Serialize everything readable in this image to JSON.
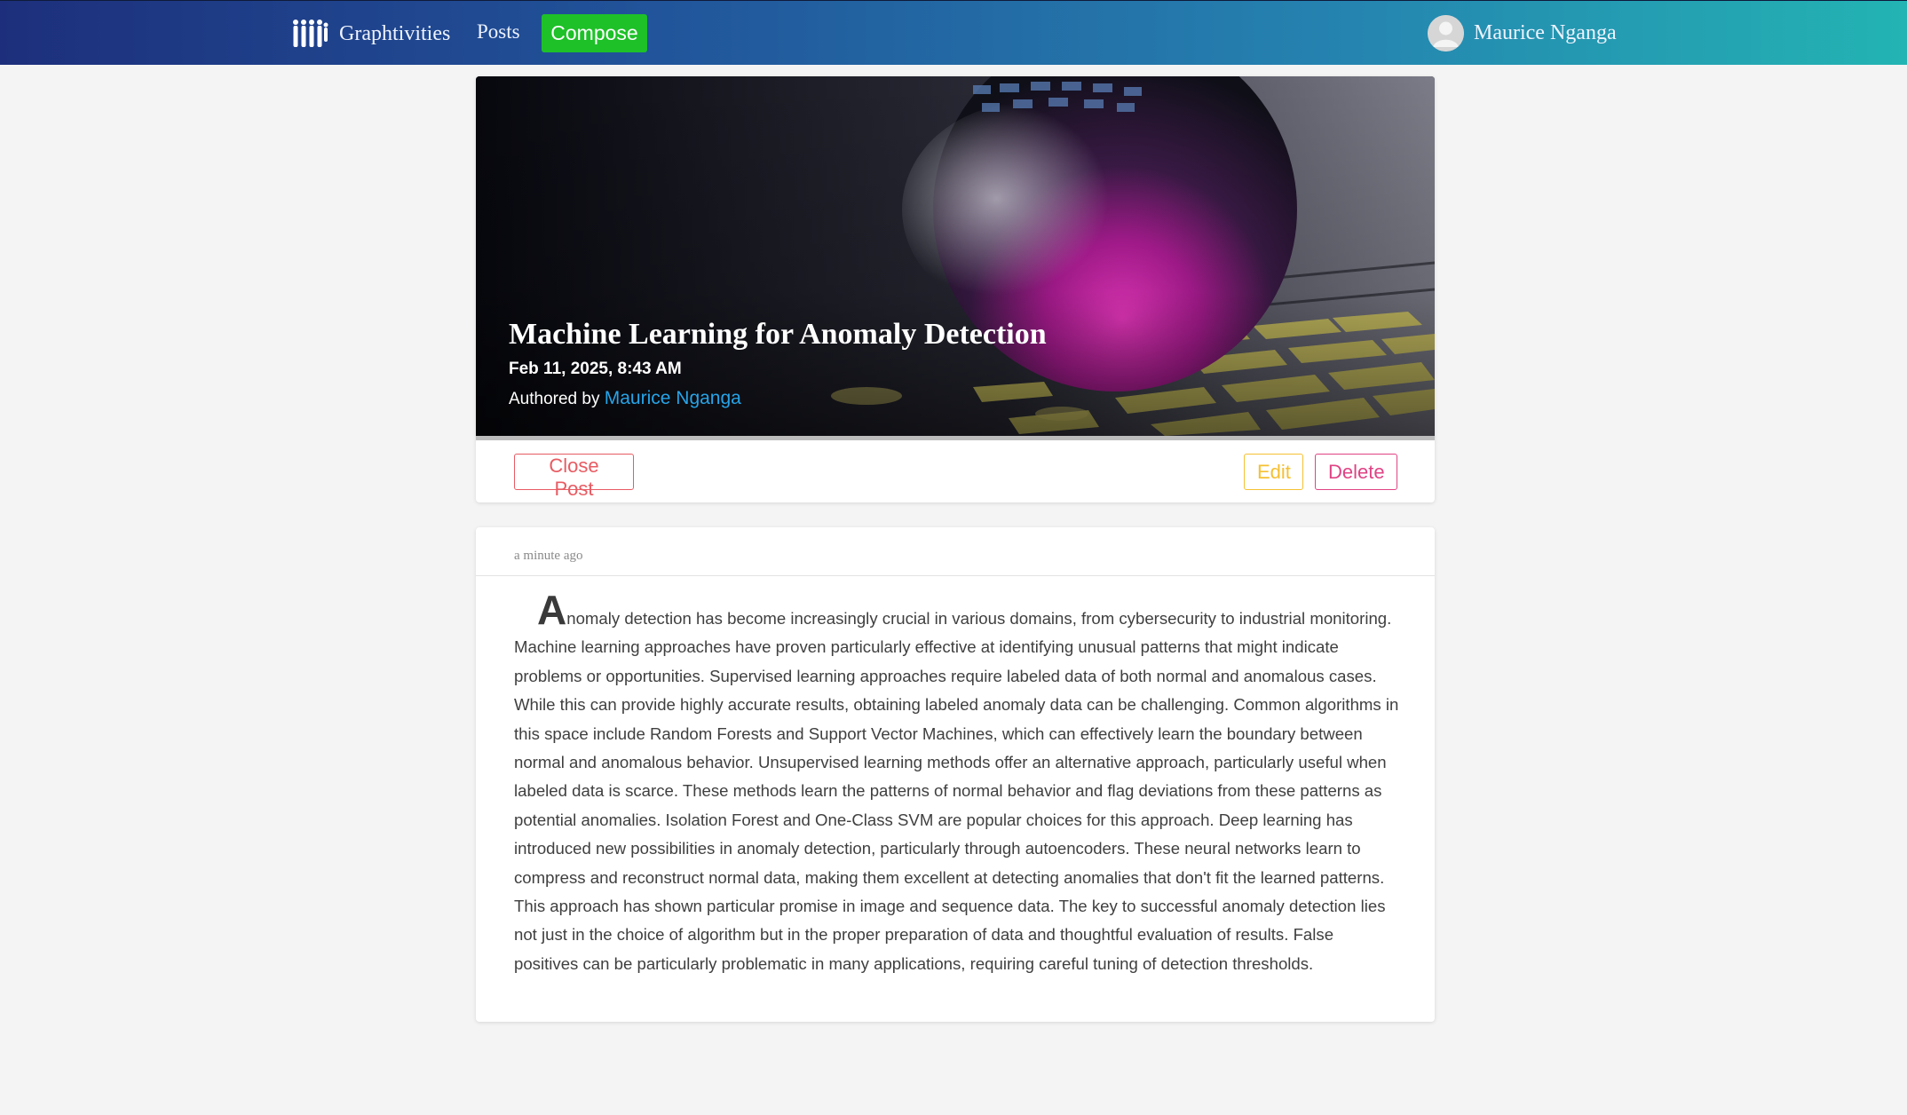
{
  "nav": {
    "brand": "Graphtivities",
    "brand_icon": "people-group-icon",
    "posts_label": "Posts",
    "compose_label": "Compose",
    "user_name": "Maurice Nganga",
    "avatar_icon": "user-avatar-icon"
  },
  "post": {
    "title": "Machine Learning for Anomaly Detection",
    "date": "Feb 11, 2025, 8:43 AM",
    "authored_prefix": "Authored by",
    "author": "Maurice Nganga",
    "close_label": "Close Post",
    "edit_label": "Edit",
    "delete_label": "Delete",
    "time_ago": "a minute ago",
    "drop_letter": "A",
    "body_rest": "nomaly detection has become increasingly crucial in various domains, from cybersecurity to industrial monitoring. Machine learning approaches have proven particularly effective at identifying unusual patterns that might indicate problems or opportunities. Supervised learning approaches require labeled data of both normal and anomalous cases. While this can provide highly accurate results, obtaining labeled anomaly data can be challenging. Common algorithms in this space include Random Forests and Support Vector Machines, which can effectively learn the boundary between normal and anomalous behavior. Unsupervised learning methods offer an alternative approach, particularly useful when labeled data is scarce. These methods learn the patterns of normal behavior and flag deviations from these patterns as potential anomalies. Isolation Forest and One-Class SVM are popular choices for this approach. Deep learning has introduced new possibilities in anomaly detection, particularly through autoencoders. These neural networks learn to compress and reconstruct normal data, making them excellent at detecting anomalies that don't fit the learned patterns. This approach has shown particular promise in image and sequence data. The key to successful anomaly detection lies not just in the choice of algorithm but in the proper preparation of data and thoughtful evaluation of results. False positives can be particularly problematic in many applications, requiring careful tuning of detection thresholds."
  },
  "colors": {
    "compose": "#1ec128",
    "close": "#e85b62",
    "edit": "#f5c033",
    "delete": "#e04384",
    "author_link": "#27a4e8"
  }
}
